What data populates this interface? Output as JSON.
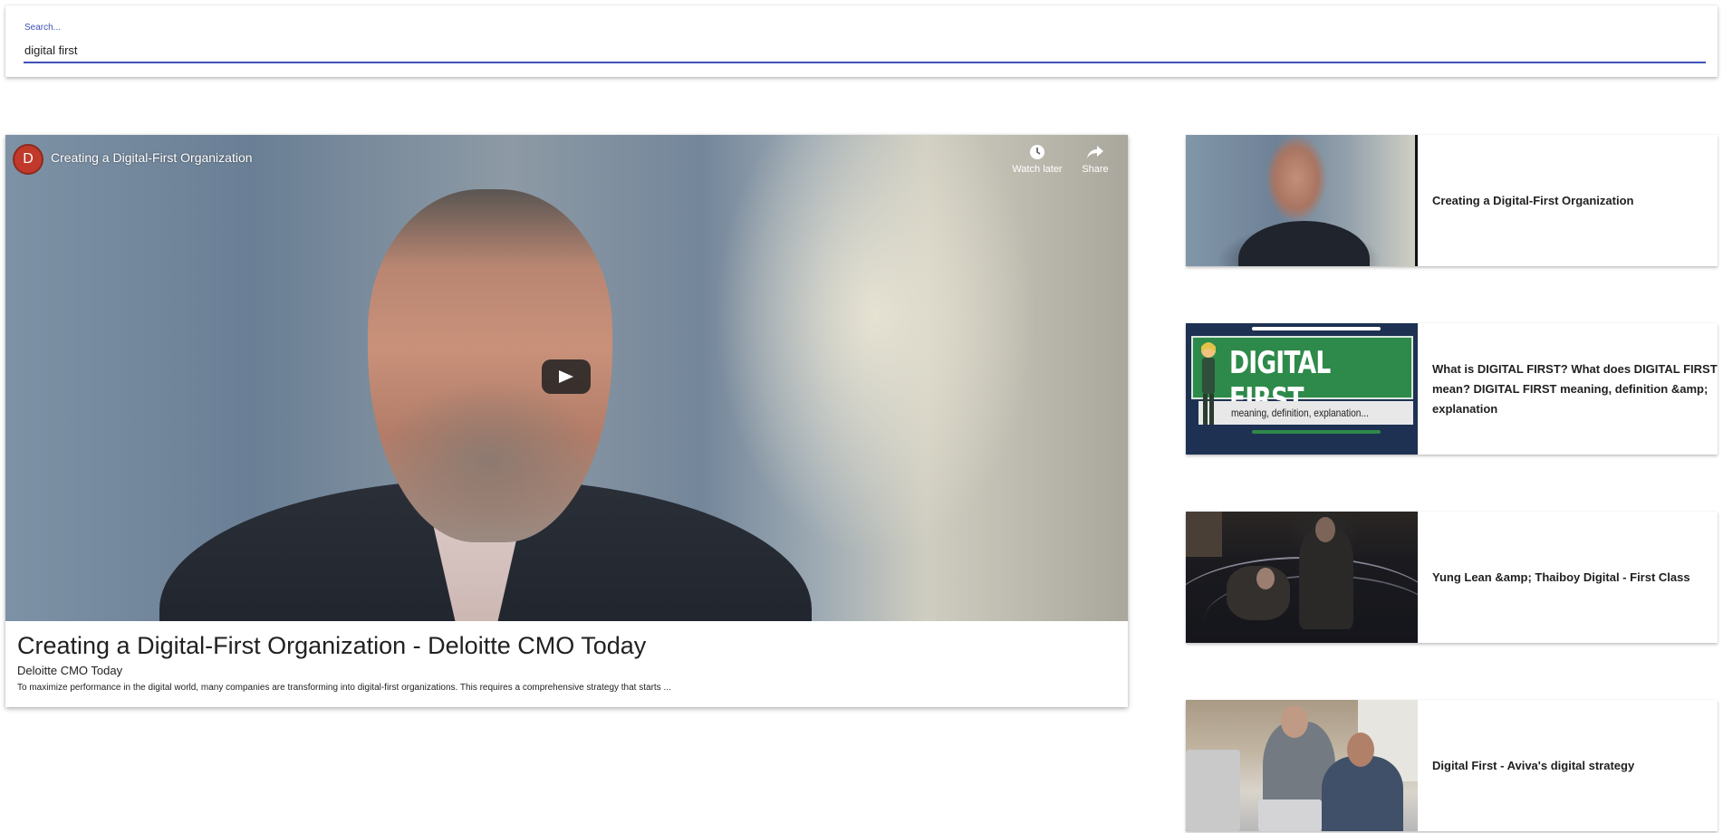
{
  "search": {
    "label": "Search...",
    "value": "digital first"
  },
  "player": {
    "channel_avatar_letter": "D",
    "overlay_title": "Creating a Digital-First Organization",
    "watch_later_label": "Watch later",
    "share_label": "Share"
  },
  "main_video": {
    "title": "Creating a Digital-First Organization - Deloitte CMO Today",
    "channel": "Deloitte CMO Today",
    "description": "To maximize performance in the digital world, many companies are transforming into digital-first organizations. This requires a comprehensive strategy that starts ..."
  },
  "related": [
    {
      "title": "Creating a Digital-First Organization"
    },
    {
      "title": "What is DIGITAL FIRST? What does DIGITAL FIRST mean? DIGITAL FIRST meaning, definition &amp; explanation",
      "thumb_heading": "DIGITAL FIRST",
      "thumb_subheading": "meaning, definition, explanation..."
    },
    {
      "title": "Yung Lean &amp; Thaiboy Digital - First Class"
    },
    {
      "title": "Digital First - Aviva's digital strategy"
    }
  ],
  "colors": {
    "accent": "#3f51b5",
    "youtube_play": "#212121",
    "thumb_green": "#2e8a4a",
    "thumb_navy": "#1e3152"
  },
  "icons": {
    "watch_later": "clock-icon",
    "share": "share-arrow-icon",
    "play": "play-icon"
  }
}
